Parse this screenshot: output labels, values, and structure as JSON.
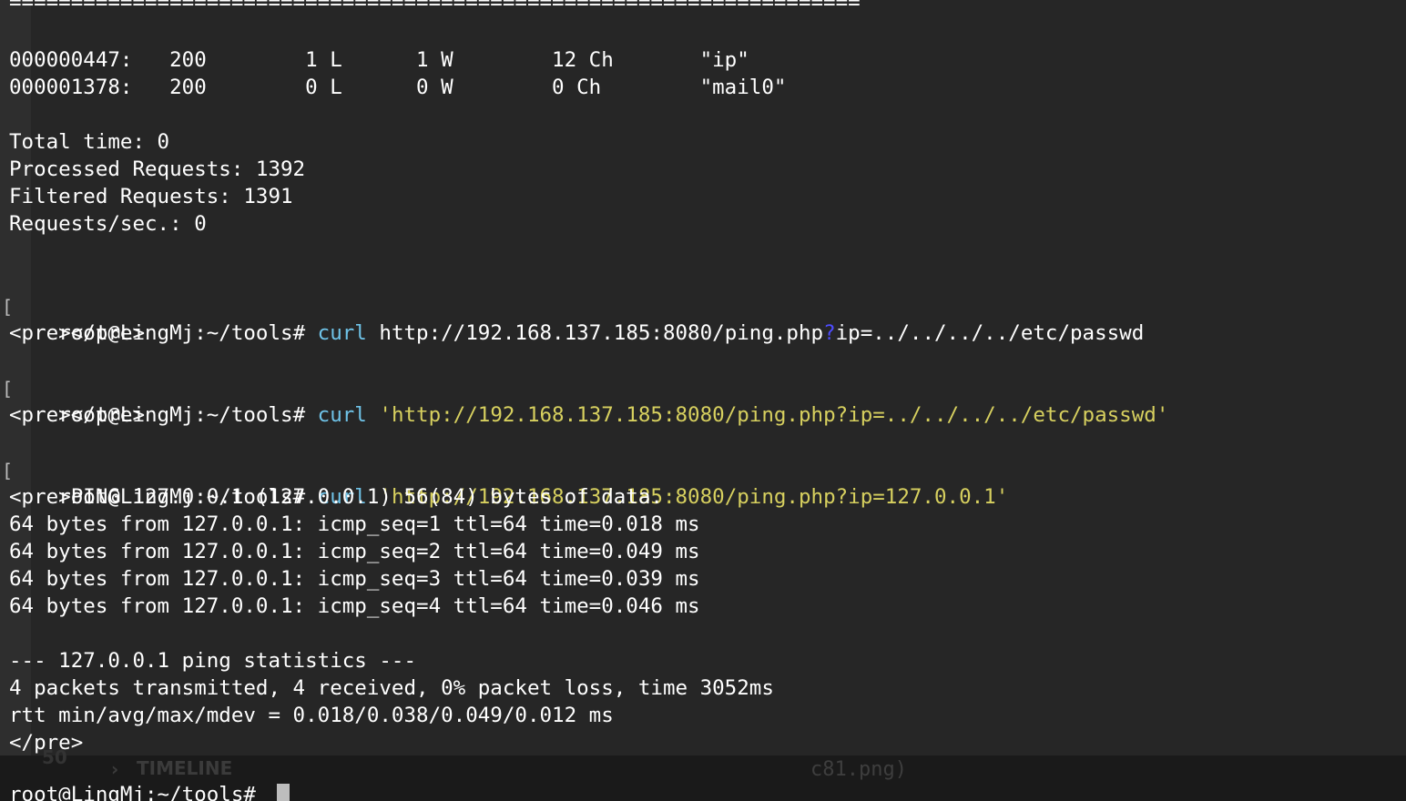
{
  "terminal": {
    "separator": "=====================================================================",
    "results": [
      "000000447:   200        1 L      1 W        12 Ch       \"ip\"",
      "000001378:   200        0 L      0 W        0 Ch        \"mail0\""
    ],
    "summary": [
      "Total time: 0",
      "Processed Requests: 1392",
      "Filtered Requests: 1391",
      "Requests/sec.: 0"
    ],
    "prompt": "root@LingMj:~/tools# ",
    "curl_cmd": "curl",
    "command1": {
      "url_before": "http://192.168.137.185:8080/ping.php",
      "q": "?",
      "url_after": "ip=../../../../etc/passwd",
      "output": "<pre></pre>"
    },
    "command2": {
      "url": "'http://192.168.137.185:8080/ping.php?ip=../../../../etc/passwd'",
      "output": "<pre></pre>"
    },
    "command3": {
      "url": "'http://192.168.137.185:8080/ping.php?ip=127.0.0.1'",
      "output": [
        "<pre>PING 127.0.0.1 (127.0.0.1) 56(84) bytes of data.",
        "64 bytes from 127.0.0.1: icmp_seq=1 ttl=64 time=0.018 ms",
        "64 bytes from 127.0.0.1: icmp_seq=2 ttl=64 time=0.049 ms",
        "64 bytes from 127.0.0.1: icmp_seq=3 ttl=64 time=0.039 ms",
        "64 bytes from 127.0.0.1: icmp_seq=4 ttl=64 time=0.046 ms",
        "",
        "--- 127.0.0.1 ping statistics ---",
        "4 packets transmitted, 4 received, 0% packet loss, time 3052ms",
        "rtt min/avg/max/mdev = 0.018/0.038/0.049/0.012 ms",
        "</pre>"
      ]
    },
    "final_prompt": "root@LingMj:~/tools# "
  },
  "background_panel": {
    "timeline_label": "TIMELINE",
    "number": "50",
    "file_name": "c81.png)"
  },
  "colors": {
    "background": "#262626",
    "command": "#6fc3e8",
    "string": "#d7d05f",
    "highlight": "#4e4cff"
  }
}
